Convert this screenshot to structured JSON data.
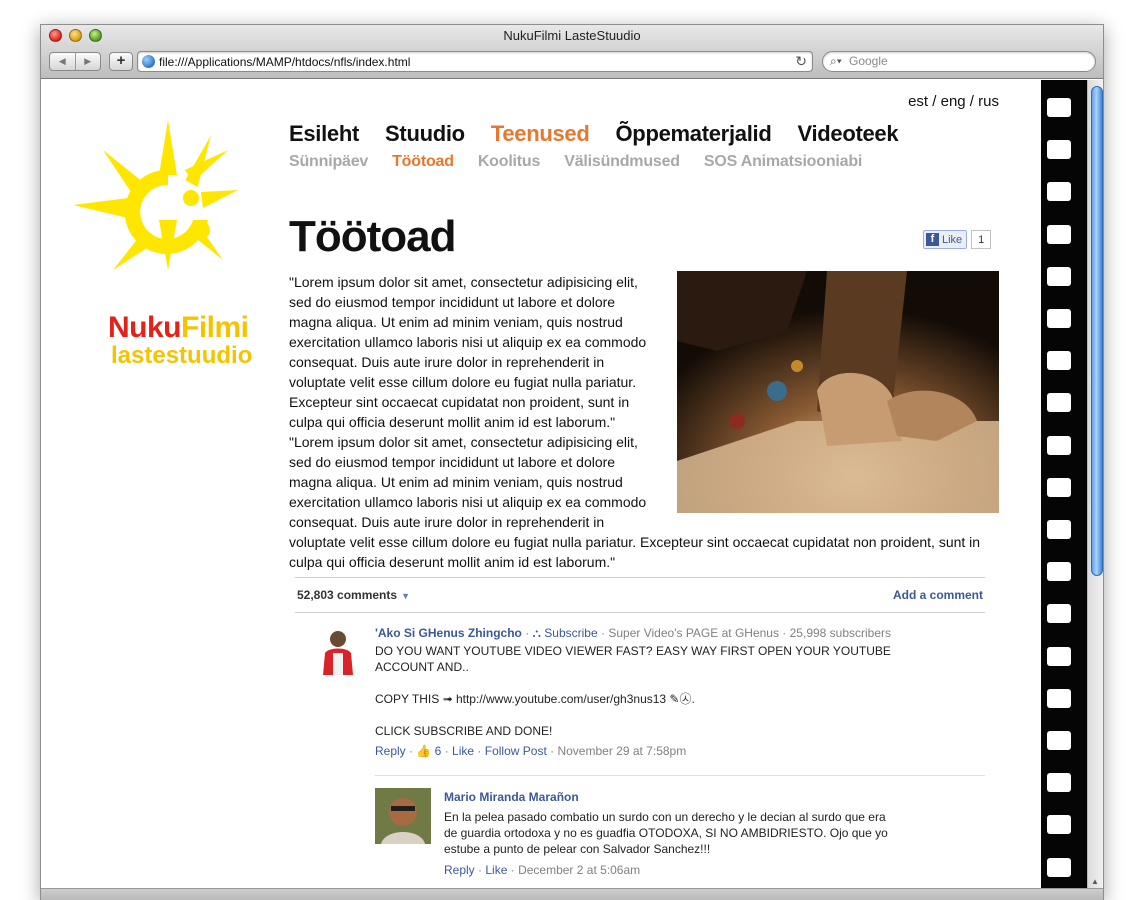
{
  "window": {
    "title": "NukuFilmi LasteStuudio",
    "url": "file:///Applications/MAMP/htdocs/nfls/index.html",
    "search_placeholder": "Google",
    "back_icon": "chevron-left-icon",
    "forward_icon": "chevron-right-icon",
    "add_label": "+",
    "reload_icon": "reload-icon"
  },
  "logo": {
    "part1": "Nuku",
    "part2": "Filmi",
    "line2": "lastestuudio",
    "colors": {
      "red": "#e2231a",
      "yellow": "#f5c400"
    }
  },
  "languages": [
    "est",
    "eng",
    "rus"
  ],
  "language_separator": " / ",
  "nav": {
    "main": [
      "Esileht",
      "Stuudio",
      "Teenused",
      "Õppematerjalid",
      "Videoteek"
    ],
    "active_main": "Teenused",
    "sub": [
      "Sünnipäev",
      "Töötoad",
      "Koolitus",
      "Välisündmused",
      "SOS Animatsiooniabi"
    ],
    "active_sub": "Töötoad",
    "accent_color": "#e8772e"
  },
  "page": {
    "title": "Töötoad",
    "like_label": "Like",
    "like_count": "1",
    "body": "\"Lorem ipsum dolor sit amet, consectetur adipisicing elit, sed do eiusmod tempor incididunt ut labore et dolore magna aliqua. Ut enim ad minim veniam, quis nostrud exercitation ullamco laboris nisi ut aliquip ex ea commodo consequat. Duis aute irure dolor in reprehenderit in voluptate velit esse cillum dolore eu fugiat nulla pariatur. Excepteur sint occaecat cupidatat non proident, sunt in culpa qui officia deserunt mollit anim id est laborum.\" \"Lorem ipsum dolor sit amet, consectetur adipisicing elit, sed do eiusmod tempor incididunt ut labore et dolore magna aliqua. Ut enim ad minim veniam, quis nostrud exercitation ullamco laboris nisi ut aliquip ex ea commodo consequat. Duis aute irure dolor in reprehenderit in voluptate velit esse cillum dolore eu fugiat nulla pariatur. Excepteur sint occaecat cupidatat non proident, sunt in culpa qui officia deserunt mollit anim id est laborum.\""
  },
  "comments": {
    "count_label": "52,803 comments",
    "add_label": "Add a comment",
    "items": [
      {
        "author": "'Ako Si GHenus Zhingcho",
        "subscribe": "Subscribe",
        "meta": "Super Video's PAGE at GHenus · 25,998 subscribers",
        "lines": [
          "DO YOU WANT YOUTUBE VIDEO VIEWER FAST? EASY WAY FIRST OPEN YOUR YOUTUBE",
          "ACCOUNT AND..",
          "COPY THIS ➟ http://www.youtube.com/user/gh3nus13 ✎㉦.",
          "CLICK SUBSCRIBE AND DONE!"
        ],
        "reply": "Reply",
        "likes": "6",
        "like": "Like",
        "follow": "Follow Post",
        "date": "November 29 at 7:58pm"
      },
      {
        "author": "Mario Miranda Marañon",
        "lines": [
          "En la pelea pasado combatio un surdo con un derecho y le decian al surdo que era",
          "de guardia ortodoxa y no es guadfia OTODOXA, SI NO AMBIDRIESTO. Ojo que yo",
          "estube a punto de pelear con Salvador Sanchez!!!"
        ],
        "reply": "Reply",
        "like": "Like",
        "date": "December 2 at 5:06am"
      }
    ]
  }
}
